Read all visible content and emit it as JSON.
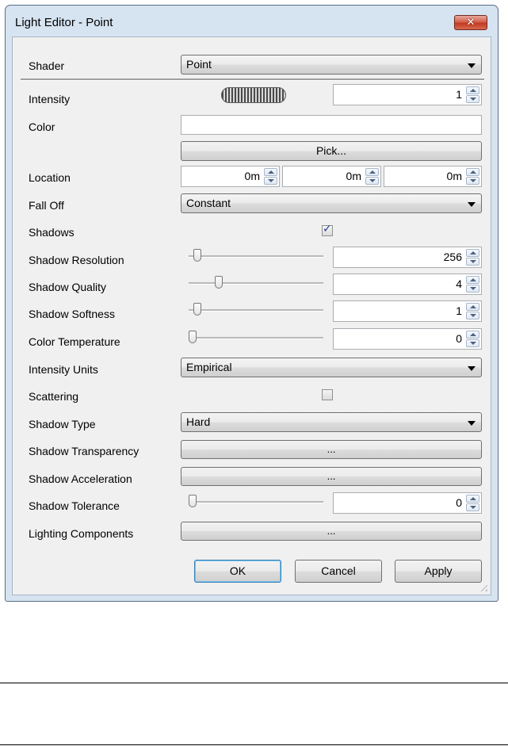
{
  "window": {
    "title": "Light Editor - Point",
    "close_label": "✕"
  },
  "rows": {
    "shader": {
      "label": "Shader",
      "value": "Point"
    },
    "intensity": {
      "label": "Intensity",
      "value": "1"
    },
    "color": {
      "label": "Color",
      "pick_label": "Pick..."
    },
    "location": {
      "label": "Location",
      "x": "0m",
      "y": "0m",
      "z": "0m"
    },
    "fall_off": {
      "label": "Fall Off",
      "value": "Constant"
    },
    "shadows": {
      "label": "Shadows",
      "checked": true,
      "check_mark": "✓"
    },
    "shadow_resolution": {
      "label": "Shadow Resolution",
      "value": "256",
      "slider_level": 0.05
    },
    "shadow_quality": {
      "label": "Shadow Quality",
      "value": "4",
      "slider_level": 0.2
    },
    "shadow_softness": {
      "label": "Shadow Softness",
      "value": "1",
      "slider_level": 0.05
    },
    "color_temperature": {
      "label": "Color Temperature",
      "value": "0",
      "slider_level": 0.0
    },
    "intensity_units": {
      "label": "Intensity Units",
      "value": "Empirical"
    },
    "scattering": {
      "label": "Scattering",
      "checked": false
    },
    "shadow_type": {
      "label": "Shadow Type",
      "value": "Hard"
    },
    "shadow_transparency": {
      "label": "Shadow Transparency",
      "button": "..."
    },
    "shadow_acceleration": {
      "label": "Shadow Acceleration",
      "button": "..."
    },
    "shadow_tolerance": {
      "label": "Shadow Tolerance",
      "value": "0",
      "slider_level": 0.0
    },
    "lighting_components": {
      "label": "Lighting Components",
      "button": "..."
    }
  },
  "footer": {
    "ok": "OK",
    "cancel": "Cancel",
    "apply": "Apply"
  },
  "colors": {
    "accent": "#3399ff",
    "close": "#c23b22",
    "dialog_bg": "#f0f0f0",
    "frame": "#d6e3f1"
  }
}
